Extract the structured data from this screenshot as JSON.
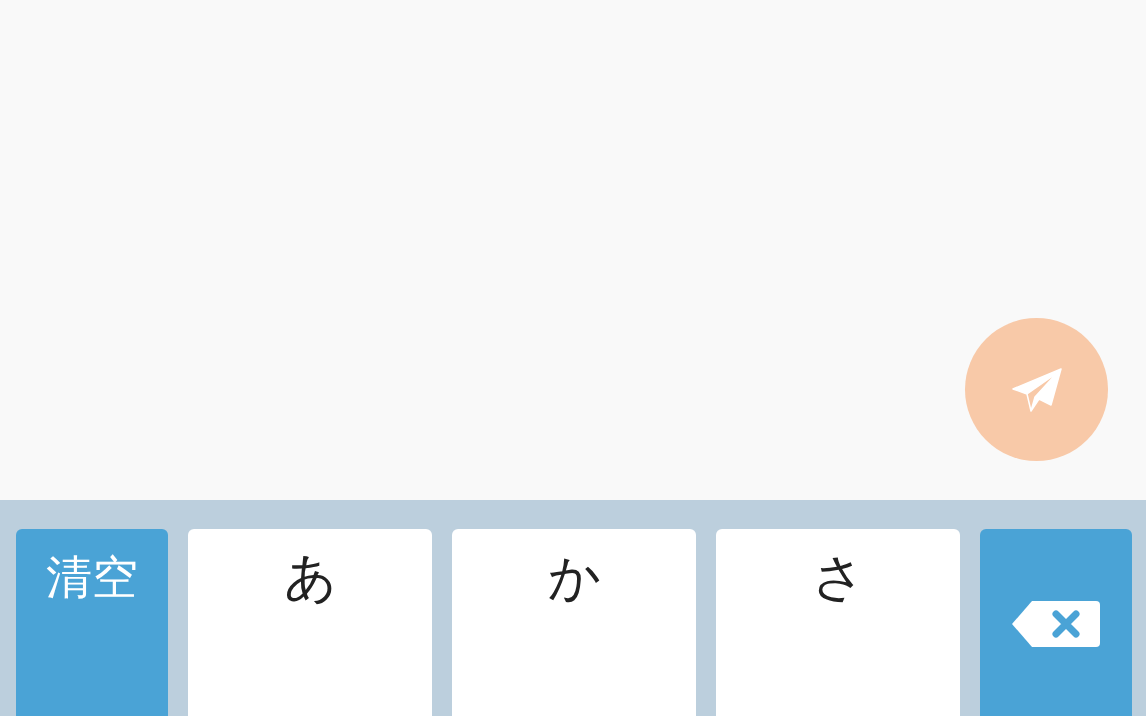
{
  "keyboard": {
    "keys": [
      {
        "kind": "action",
        "label": "清空"
      },
      {
        "kind": "char",
        "label": "あ"
      },
      {
        "kind": "char",
        "label": "か"
      },
      {
        "kind": "char",
        "label": "さ"
      },
      {
        "kind": "backspace"
      }
    ]
  }
}
